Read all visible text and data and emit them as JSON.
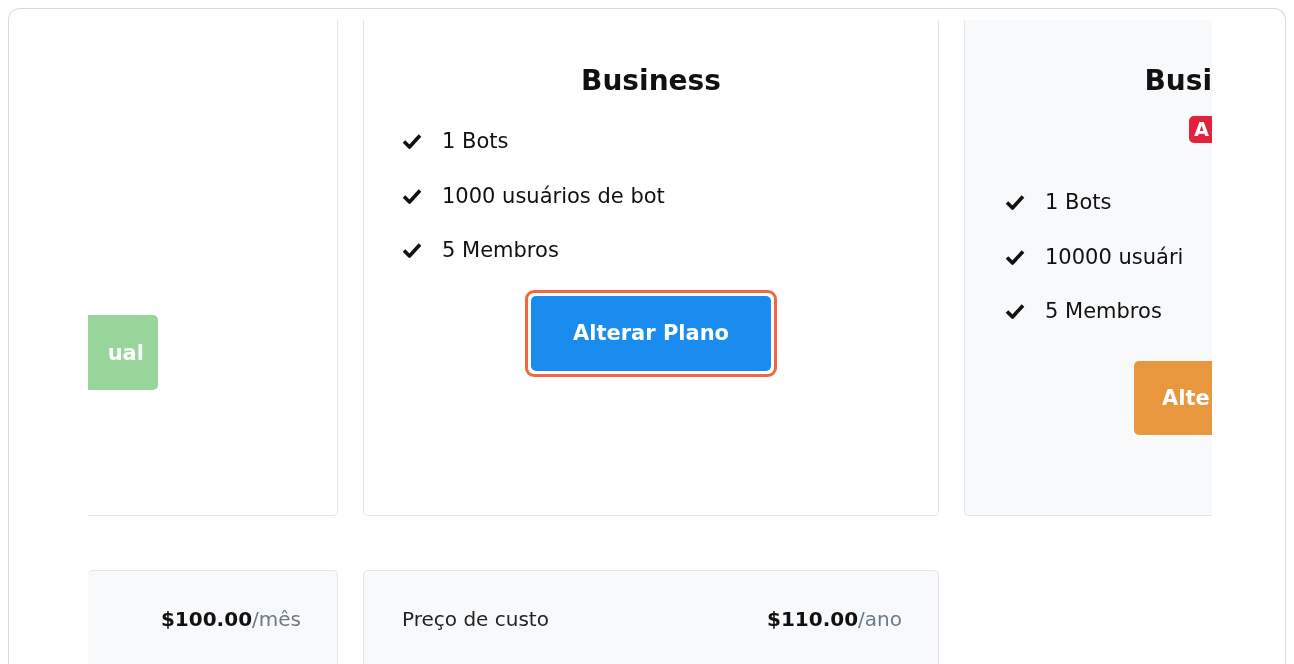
{
  "plans": [
    {
      "kind": "clipped-left",
      "button": {
        "label": "ual",
        "kind": "current",
        "highlighted": false
      }
    },
    {
      "kind": "full",
      "title": "Business",
      "features": [
        "1 Bots",
        "1000 usuários de bot",
        "5 Membros"
      ],
      "button": {
        "label": "Alterar Plano",
        "kind": "change",
        "highlighted": true
      }
    },
    {
      "kind": "clipped-right",
      "title": "Busi",
      "badge": "A",
      "features": [
        "1 Bots",
        "10000 usuári",
        "5 Membros"
      ],
      "button": {
        "label": "Alte",
        "kind": "upgrade",
        "highlighted": false
      }
    }
  ],
  "prices": [
    {
      "amount": "$100.00",
      "period": "/mês"
    },
    {
      "label": "Preço de custo",
      "amount": "$110.00",
      "period": "/ano"
    }
  ]
}
